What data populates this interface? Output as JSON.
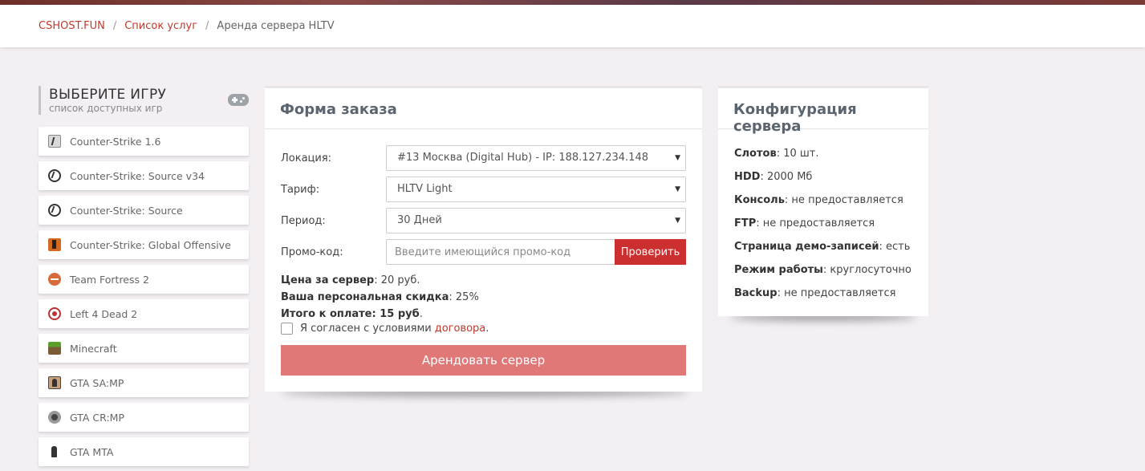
{
  "breadcrumb": {
    "home": "CSHOST.FUN",
    "services": "Список услуг",
    "current": "Аренда сервера HLTV",
    "separator": "/"
  },
  "sidebar": {
    "title": "ВЫБЕРИТЕ ИГРУ",
    "subtitle": "список доступных игр",
    "icon": "gamepad-icon",
    "games": [
      {
        "label": "Counter-Strike 1.6",
        "icon": "cs16-icon"
      },
      {
        "label": "Counter-Strike: Source v34",
        "icon": "css-v34-icon"
      },
      {
        "label": "Counter-Strike: Source",
        "icon": "css-icon"
      },
      {
        "label": "Counter-Strike: Global Offensive",
        "icon": "csgo-icon"
      },
      {
        "label": "Team Fortress 2",
        "icon": "tf2-icon"
      },
      {
        "label": "Left 4 Dead 2",
        "icon": "l4d2-icon"
      },
      {
        "label": "Minecraft",
        "icon": "minecraft-icon"
      },
      {
        "label": "GTA SA:MP",
        "icon": "gta-samp-icon"
      },
      {
        "label": "GTA CR:MP",
        "icon": "gta-crmp-icon"
      },
      {
        "label": "GTA MTA",
        "icon": "gta-mta-icon"
      }
    ]
  },
  "order": {
    "title": "Форма заказа",
    "location_label": "Локация:",
    "location_value": "#13 Москва (Digital Hub) - IP: 188.127.234.148",
    "tariff_label": "Тариф:",
    "tariff_value": "HLTV Light",
    "period_label": "Период:",
    "period_value": "30 Дней",
    "promo_label": "Промо-код:",
    "promo_placeholder": "Введите имеющийся промо-код",
    "promo_value": "",
    "check_button": "Проверить",
    "price_label": "Цена за сервер",
    "price_value": ": 20 руб.",
    "discount_label": "Ваша персональная скидка",
    "discount_value": ": 25%",
    "total_label": "Итого к оплате: 15 руб",
    "total_suffix": ".",
    "agree_text": "Я согласен с условиями",
    "agree_link": "договора",
    "agree_dot": ".",
    "agree_checked": false,
    "rent_button": "Арендовать сервер"
  },
  "config": {
    "title": "Конфигурация сервера",
    "items": [
      {
        "label": "Слотов",
        "value": ": 10 шт."
      },
      {
        "label": "HDD",
        "value": ": 2000 Мб"
      },
      {
        "label": "Консоль",
        "value": ": не предоставляется"
      },
      {
        "label": "FTP",
        "value": ": не предоставляется"
      },
      {
        "label": "Страница демо-записей",
        "value": ": есть"
      },
      {
        "label": "Режим работы",
        "value": ": круглосуточно"
      },
      {
        "label": "Backup",
        "value": ": не предоставляется"
      }
    ]
  },
  "colors": {
    "accent": "#c0392b",
    "button_red": "#cc2f2f",
    "rent_button": "#e07878",
    "page_bg": "#f3eff3"
  }
}
